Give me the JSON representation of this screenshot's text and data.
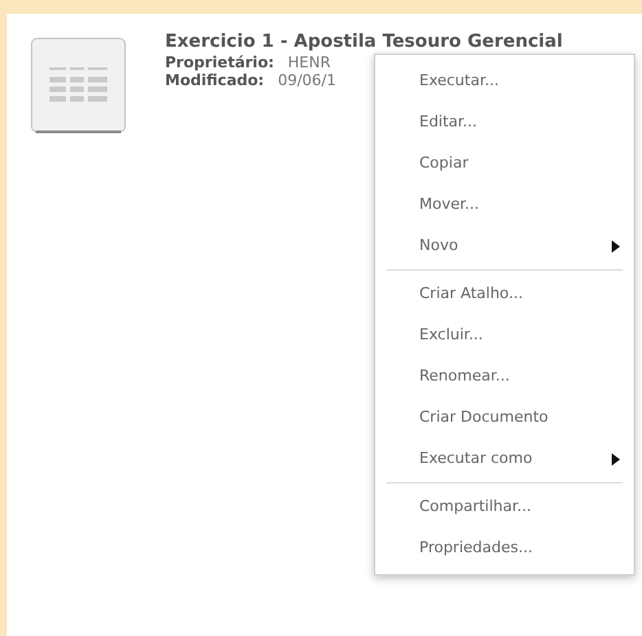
{
  "file": {
    "title": "Exercicio 1 - Apostila Tesouro Gerencial",
    "fields": [
      {
        "label": "Proprietário:",
        "value": "HENR"
      },
      {
        "label": "Modificado:",
        "value": "09/06/1"
      }
    ]
  },
  "context_menu": {
    "groups": [
      [
        {
          "label": "Executar...",
          "submenu": false
        },
        {
          "label": "Editar...",
          "submenu": false
        },
        {
          "label": "Copiar",
          "submenu": false
        },
        {
          "label": "Mover...",
          "submenu": false
        },
        {
          "label": "Novo",
          "submenu": true
        }
      ],
      [
        {
          "label": "Criar Atalho...",
          "submenu": false
        },
        {
          "label": "Excluir...",
          "submenu": false
        },
        {
          "label": "Renomear...",
          "submenu": false
        },
        {
          "label": "Criar Documento",
          "submenu": false
        },
        {
          "label": "Executar como",
          "submenu": true
        }
      ],
      [
        {
          "label": "Compartilhar...",
          "submenu": false
        },
        {
          "label": "Propriedades...",
          "submenu": false
        }
      ]
    ]
  }
}
